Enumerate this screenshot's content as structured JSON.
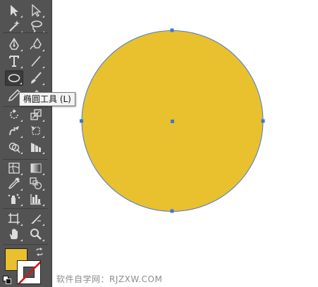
{
  "toolbar": {
    "tools": [
      {
        "name": "selection-tool",
        "icon": "arrow-icon",
        "col": 0,
        "row": 0
      },
      {
        "name": "direct-selection-tool",
        "icon": "hollow-arrow-icon",
        "col": 1,
        "row": 0
      },
      {
        "name": "magic-wand-tool",
        "icon": "magic-wand-icon",
        "col": 0,
        "row": 1
      },
      {
        "name": "lasso-tool",
        "icon": "lasso-icon",
        "col": 1,
        "row": 1
      },
      {
        "name": "pen-tool",
        "icon": "pen-icon",
        "col": 0,
        "row": 2
      },
      {
        "name": "curvature-tool",
        "icon": "curvature-pen-icon",
        "col": 1,
        "row": 2
      },
      {
        "name": "type-tool",
        "icon": "type-icon",
        "col": 0,
        "row": 3
      },
      {
        "name": "line-segment-tool",
        "icon": "line-icon",
        "col": 1,
        "row": 3
      },
      {
        "name": "ellipse-tool",
        "icon": "ellipse-icon",
        "col": 0,
        "row": 4,
        "active": true
      },
      {
        "name": "paintbrush-tool",
        "icon": "brush-icon",
        "col": 1,
        "row": 4
      },
      {
        "name": "pencil-tool",
        "icon": "pencil-icon",
        "col": 0,
        "row": 5
      },
      {
        "name": "eraser-tool",
        "icon": "eraser-icon",
        "col": 1,
        "row": 5
      },
      {
        "name": "rotate-tool",
        "icon": "rotate-icon",
        "col": 0,
        "row": 6
      },
      {
        "name": "scale-tool",
        "icon": "scale-icon",
        "col": 1,
        "row": 6
      },
      {
        "name": "warp-tool",
        "icon": "warp-icon",
        "col": 0,
        "row": 7
      },
      {
        "name": "free-transform-tool",
        "icon": "free-transform-icon",
        "col": 1,
        "row": 7
      },
      {
        "name": "shape-builder-tool",
        "icon": "shape-builder-icon",
        "col": 0,
        "row": 8
      },
      {
        "name": "perspective-grid-tool",
        "icon": "perspective-grid-icon",
        "col": 1,
        "row": 8
      },
      {
        "name": "mesh-tool",
        "icon": "mesh-icon",
        "col": 0,
        "row": 9
      },
      {
        "name": "gradient-tool",
        "icon": "gradient-icon",
        "col": 1,
        "row": 9
      },
      {
        "name": "eyedropper-tool",
        "icon": "eyedropper-icon",
        "col": 0,
        "row": 10
      },
      {
        "name": "blend-tool",
        "icon": "blend-icon",
        "col": 1,
        "row": 10
      },
      {
        "name": "symbol-sprayer-tool",
        "icon": "symbol-sprayer-icon",
        "col": 0,
        "row": 11
      },
      {
        "name": "column-graph-tool",
        "icon": "column-graph-icon",
        "col": 1,
        "row": 11
      },
      {
        "name": "artboard-tool",
        "icon": "artboard-icon",
        "col": 0,
        "row": 12
      },
      {
        "name": "slice-tool",
        "icon": "slice-icon",
        "col": 1,
        "row": 12
      },
      {
        "name": "hand-tool",
        "icon": "hand-icon",
        "col": 0,
        "row": 13
      },
      {
        "name": "zoom-tool",
        "icon": "zoom-icon",
        "col": 1,
        "row": 13
      }
    ],
    "fill_color": "#e9c02e",
    "stroke": "none"
  },
  "tooltip": {
    "text": "椭圆工具 (L)"
  },
  "canvas": {
    "shape": "ellipse",
    "fill_color": "#e9c02e",
    "stroke_color": "#4a7bd0",
    "anchor_color": "#3f76d8"
  },
  "watermark": {
    "text": "软件自学网：RJZXW.COM"
  }
}
